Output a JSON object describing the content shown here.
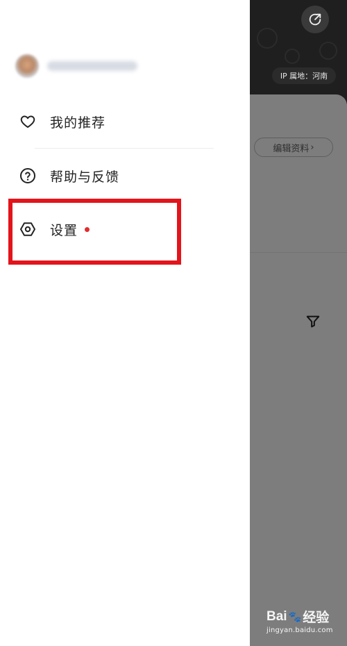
{
  "drawer": {
    "menu": [
      {
        "label": "我的推荐",
        "icon": "heart-icon"
      },
      {
        "label": "帮助与反馈",
        "icon": "help-circle-icon"
      },
      {
        "label": "设置",
        "icon": "settings-icon",
        "badge": "red-dot"
      }
    ],
    "highlight_color": "#e3141b"
  },
  "background_page": {
    "ip_location": "IP 属地：河南",
    "edit_profile_label": "编辑资料",
    "share_icon": "share-icon",
    "filter_icon": "filter-icon"
  },
  "watermark": {
    "brand_prefix": "Bai",
    "brand_suffix": "经验",
    "site": "jingyan.baidu.com"
  },
  "colors": {
    "accent_red": "#e02e2e",
    "header_dark": "#1f1f1f",
    "overlay_gray": "#7b7b7b"
  }
}
